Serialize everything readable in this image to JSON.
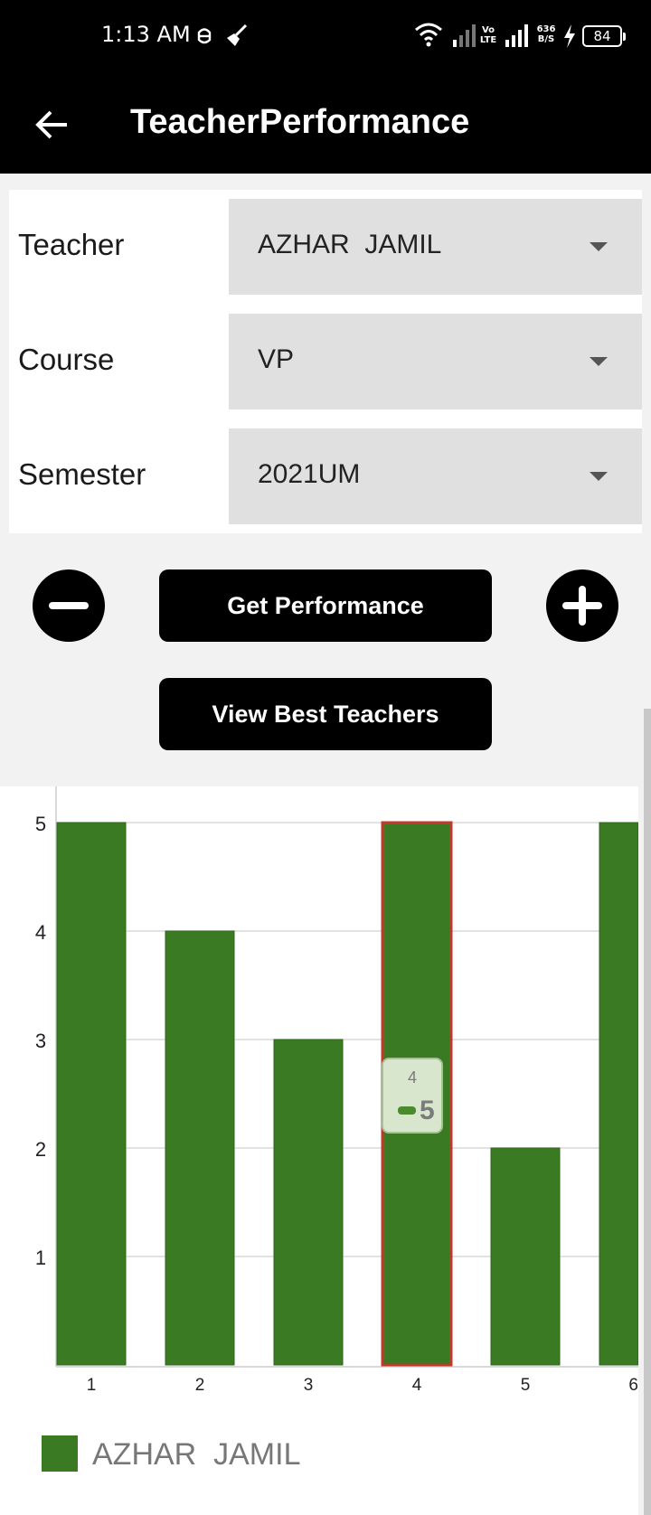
{
  "status_bar": {
    "time": "1:13 AM",
    "network_speed_top": "636",
    "network_speed_bottom": "B/S",
    "volte_top": "Vo",
    "volte_bottom": "LTE",
    "battery": "84",
    "icons": [
      "debug-icon",
      "broom-icon",
      "wifi-icon",
      "signal-icon",
      "volte-icon",
      "signal-icon",
      "charging-icon",
      "battery-icon"
    ]
  },
  "app_bar": {
    "title": "TeacherPerformance",
    "back_icon": "arrow-left-icon"
  },
  "form": {
    "teacher": {
      "label": "Teacher",
      "value": "AZHAR  JAMIL"
    },
    "course": {
      "label": "Course",
      "value": "VP"
    },
    "semester": {
      "label": "Semester",
      "value": "2021UM"
    }
  },
  "buttons": {
    "zoom_out_icon": "minus-icon",
    "zoom_in_icon": "plus-icon",
    "get_performance": "Get Performance",
    "view_best_teachers": "View Best Teachers"
  },
  "colors": {
    "bar": "#3a7a22",
    "highlight_border": "#c0392b",
    "grid": "#d9d9d9"
  },
  "chart_data": {
    "type": "bar",
    "categories": [
      "1",
      "2",
      "3",
      "4",
      "5",
      "6"
    ],
    "series": [
      {
        "name": "AZHAR  JAMIL",
        "values": [
          5,
          4,
          3,
          5,
          2,
          5
        ]
      }
    ],
    "ylim": [
      0,
      5
    ],
    "yticks": [
      "1",
      "2",
      "3",
      "4",
      "5"
    ],
    "grid": true,
    "legend": "bottom-left",
    "highlighted_index": 3,
    "tooltip": {
      "x": "4",
      "value": "5"
    }
  }
}
